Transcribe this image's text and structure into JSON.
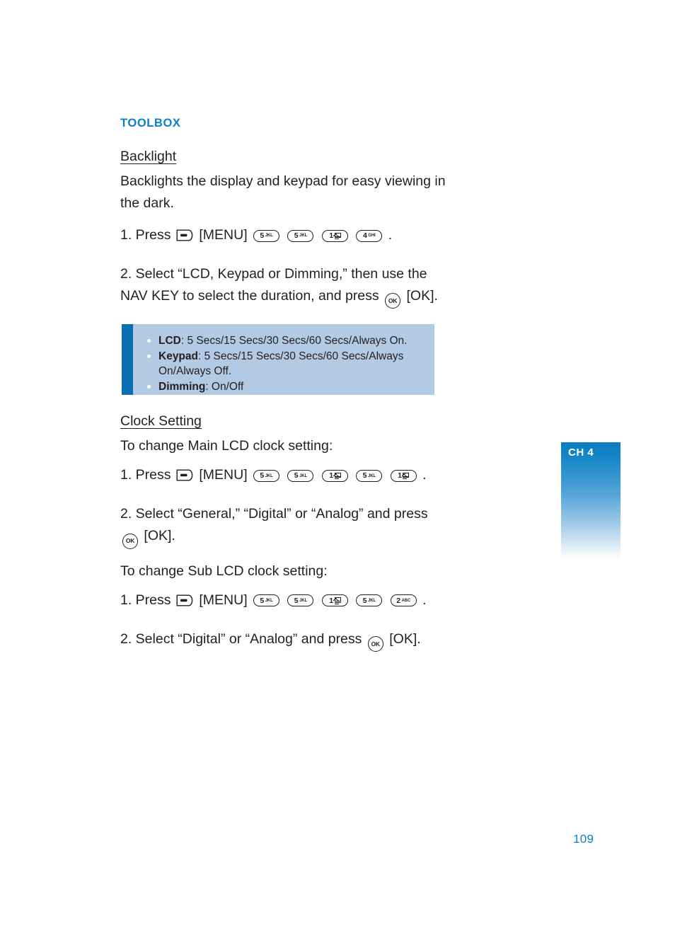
{
  "page": {
    "number": "109",
    "chapter_tab": "CH 4",
    "accent_blue": "#0d7fc4",
    "callout_bar_blue": "#0a6eb4",
    "callout_bg_blue": "#b3cae4"
  },
  "section": {
    "title": "TOOLBOX"
  },
  "backlight": {
    "heading": "Backlight",
    "description": "Backlights the display and keypad for easy viewing in the dark.",
    "step1": {
      "prefix": "1. Press",
      "softkey_label": "[MENU]",
      "keys": [
        {
          "icon": "softkey-menu-icon",
          "num": "",
          "letters": ""
        },
        {
          "icon": "key-5-jkl-icon",
          "num": "5",
          "letters": "JKL"
        },
        {
          "icon": "key-5-jkl-icon",
          "num": "5",
          "letters": "JKL"
        },
        {
          "icon": "key-1-message-icon",
          "num": "1",
          "letters": ""
        },
        {
          "icon": "key-4-ghi-icon",
          "num": "4",
          "letters": "GHI"
        }
      ],
      "suffix": "."
    },
    "step2": {
      "text_before": "2. Select “LCD, Keypad or Dimming,” then use the NAV KEY to select the duration, and press",
      "ok_key_label": "OK",
      "text_after": "[OK]."
    },
    "callout": {
      "items": [
        {
          "label": "LCD",
          "value": ": 5 Secs/15 Secs/30 Secs/60 Secs/Always On."
        },
        {
          "label": "Keypad",
          "value": ": 5 Secs/15 Secs/30 Secs/60 Secs/Always On/Always Off."
        },
        {
          "label": "Dimming",
          "value": ": On/Off"
        }
      ]
    }
  },
  "clock_setting": {
    "heading": "Clock Setting",
    "main_lcd_intro": "To change Main LCD clock setting:",
    "main_step1": {
      "prefix": "1. Press",
      "softkey_label": "[MENU]",
      "keys": [
        {
          "icon": "softkey-menu-icon",
          "num": "",
          "letters": ""
        },
        {
          "icon": "key-5-jkl-icon",
          "num": "5",
          "letters": "JKL"
        },
        {
          "icon": "key-5-jkl-icon",
          "num": "5",
          "letters": "JKL"
        },
        {
          "icon": "key-1-message-icon",
          "num": "1",
          "letters": ""
        },
        {
          "icon": "key-5-jkl-icon",
          "num": "5",
          "letters": "JKL"
        },
        {
          "icon": "key-1-message-icon",
          "num": "1",
          "letters": ""
        }
      ],
      "suffix": "."
    },
    "main_step2": {
      "text_before": "2. Select “General,” “Digital” or “Analog” and press",
      "ok_key_label": "OK",
      "text_after": "[OK]."
    },
    "sub_lcd_intro": "To change Sub LCD clock setting:",
    "sub_step1": {
      "prefix": "1. Press",
      "softkey_label": "[MENU]",
      "keys": [
        {
          "icon": "softkey-menu-icon",
          "num": "",
          "letters": ""
        },
        {
          "icon": "key-5-jkl-icon",
          "num": "5",
          "letters": "JKL"
        },
        {
          "icon": "key-5-jkl-icon",
          "num": "5",
          "letters": "JKL"
        },
        {
          "icon": "key-1-message-icon",
          "num": "1",
          "letters": ""
        },
        {
          "icon": "key-5-jkl-icon",
          "num": "5",
          "letters": "JKL"
        },
        {
          "icon": "key-2-abc-icon",
          "num": "2",
          "letters": "ABC"
        }
      ],
      "suffix": "."
    },
    "sub_step2": {
      "text_before": "2. Select “Digital” or “Analog” and press",
      "ok_key_label": "OK",
      "text_after": "[OK]."
    }
  }
}
